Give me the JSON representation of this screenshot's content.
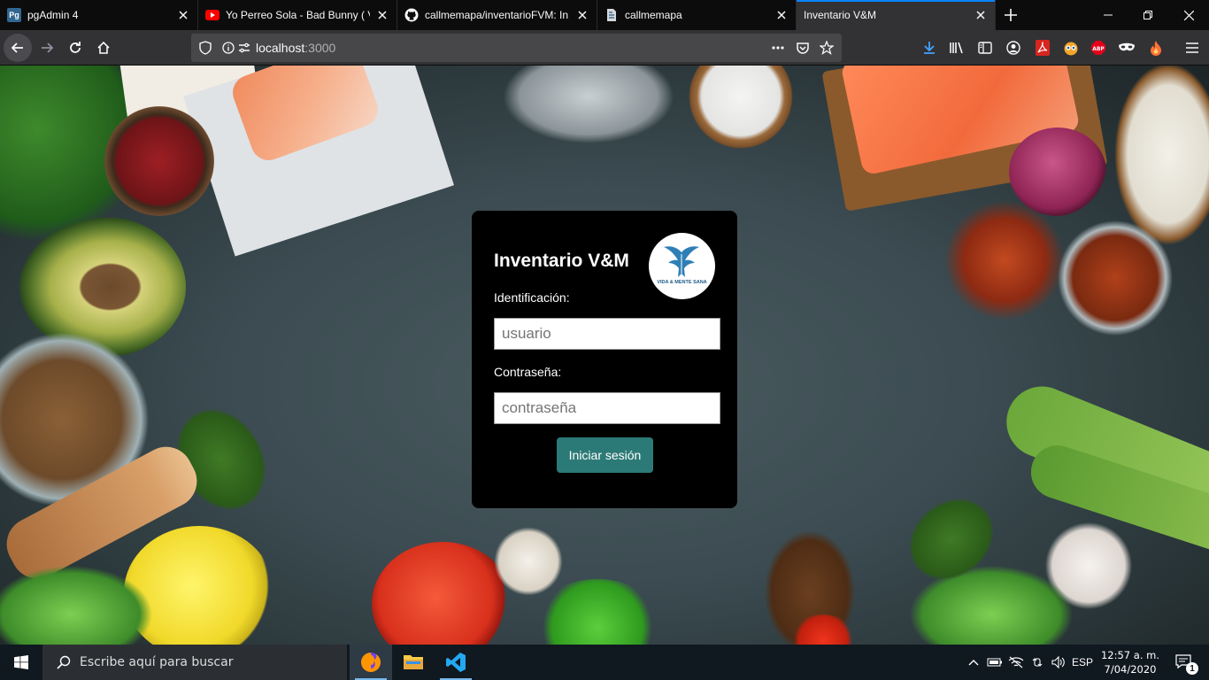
{
  "browser": {
    "tabs": [
      {
        "title": "pgAdmin 4",
        "favicon": "pgadmin-icon",
        "active": false
      },
      {
        "title": "Yo Perreo Sola - Bad Bunny ( Vi",
        "favicon": "youtube-icon",
        "active": false
      },
      {
        "title": "callmemapa/inventarioFVM: In",
        "favicon": "github-icon",
        "active": false
      },
      {
        "title": "callmemapa",
        "favicon": "page-icon",
        "active": false
      },
      {
        "title": "Inventario V&M",
        "favicon": "",
        "active": true
      }
    ],
    "url_host": "localhost",
    "url_port": ":3000",
    "accent": "#0a84ff"
  },
  "login": {
    "title": "Inventario V&M",
    "logo_text": "VIDA & MENTE SANA",
    "id_label": "Identificación:",
    "id_placeholder": "usuario",
    "pass_label": "Contraseña:",
    "pass_placeholder": "contraseña",
    "submit_label": "Iniciar sesión",
    "button_color": "#2c7a77"
  },
  "taskbar": {
    "search_placeholder": "Escribe aquí para buscar",
    "language": "ESP",
    "time": "12:57 a. m.",
    "date": "7/04/2020",
    "notification_count": "1"
  }
}
